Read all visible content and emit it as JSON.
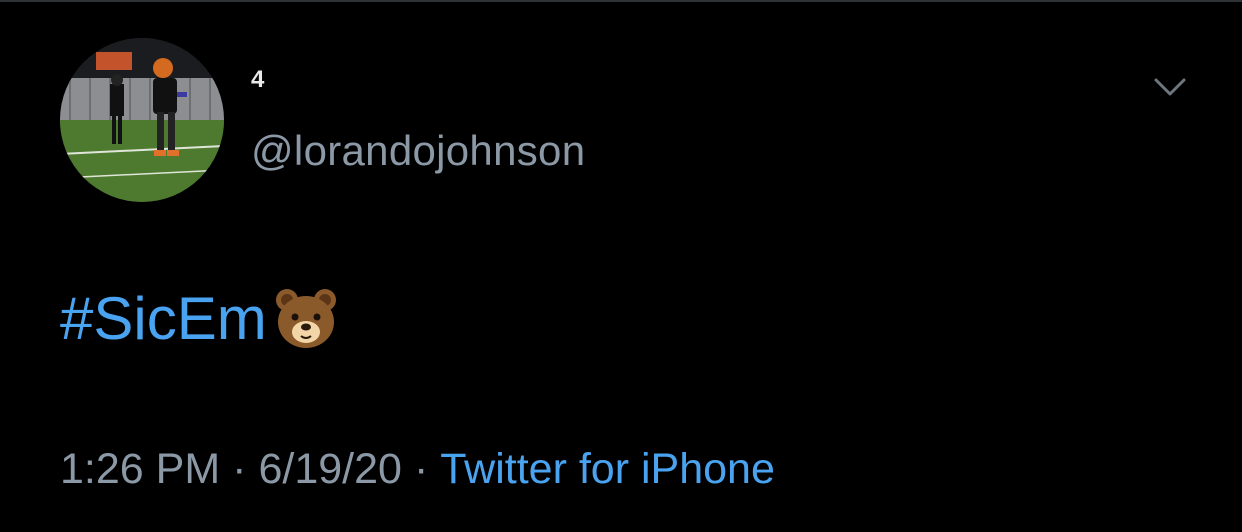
{
  "tweet": {
    "display_name": "4",
    "handle": "@lorandojohnson",
    "text_hashtag": "#SicEm",
    "text_emoji": "bear-face",
    "time": "1:26 PM",
    "separator": "·",
    "date": "6/19/20",
    "source": "Twitter for iPhone"
  },
  "icons": {
    "menu": "chevron-down-icon",
    "avatar": "profile-photo-football-player"
  },
  "colors": {
    "background": "#000000",
    "link": "#4aa3f0",
    "secondary_text": "#8b98a5",
    "primary_text": "#e7e9ea"
  }
}
